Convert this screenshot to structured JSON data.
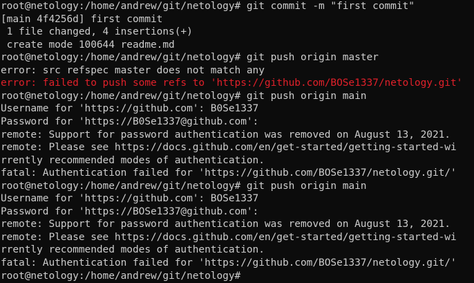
{
  "terminal": {
    "colors": {
      "background": "#0c0c0c",
      "text": "#cccccc",
      "error": "#e0202a"
    },
    "lines": [
      {
        "text": "root@netology:/home/andrew/git/netology# git commit -m \"first commit\"",
        "style": "normal"
      },
      {
        "text": "[main 4f4256d] first commit",
        "style": "normal"
      },
      {
        "text": " 1 file changed, 4 insertions(+)",
        "style": "normal"
      },
      {
        "text": " create mode 100644 readme.md",
        "style": "normal"
      },
      {
        "text": "root@netology:/home/andrew/git/netology# git push origin master",
        "style": "normal"
      },
      {
        "text": "error: src refspec master does not match any",
        "style": "normal"
      },
      {
        "text": "error: failed to push some refs to 'https://github.com/BOSe1337/netology.git'",
        "style": "error"
      },
      {
        "text": "root@netology:/home/andrew/git/netology# git push origin main",
        "style": "normal"
      },
      {
        "text": "Username for 'https://github.com': B0Se1337",
        "style": "normal"
      },
      {
        "text": "Password for 'https://B0Se1337@github.com':",
        "style": "normal"
      },
      {
        "text": "remote: Support for password authentication was removed on August 13, 2021.",
        "style": "normal"
      },
      {
        "text": "remote: Please see https://docs.github.com/en/get-started/getting-started-wi",
        "style": "normal"
      },
      {
        "text": "rrently recommended modes of authentication.",
        "style": "normal"
      },
      {
        "text": "fatal: Authentication failed for 'https://github.com/BOSe1337/netology.git/'",
        "style": "normal"
      },
      {
        "text": "root@netology:/home/andrew/git/netology# git push origin main",
        "style": "normal"
      },
      {
        "text": "Username for 'https://github.com': BOSe1337",
        "style": "normal"
      },
      {
        "text": "Password for 'https://BOSe1337@github.com':",
        "style": "normal"
      },
      {
        "text": "remote: Support for password authentication was removed on August 13, 2021.",
        "style": "normal"
      },
      {
        "text": "remote: Please see https://docs.github.com/en/get-started/getting-started-wi",
        "style": "normal"
      },
      {
        "text": "rrently recommended modes of authentication.",
        "style": "normal"
      },
      {
        "text": "fatal: Authentication failed for 'https://github.com/BOSe1337/netology.git/'",
        "style": "normal"
      },
      {
        "text": "root@netology:/home/andrew/git/netology#",
        "style": "normal"
      }
    ]
  }
}
